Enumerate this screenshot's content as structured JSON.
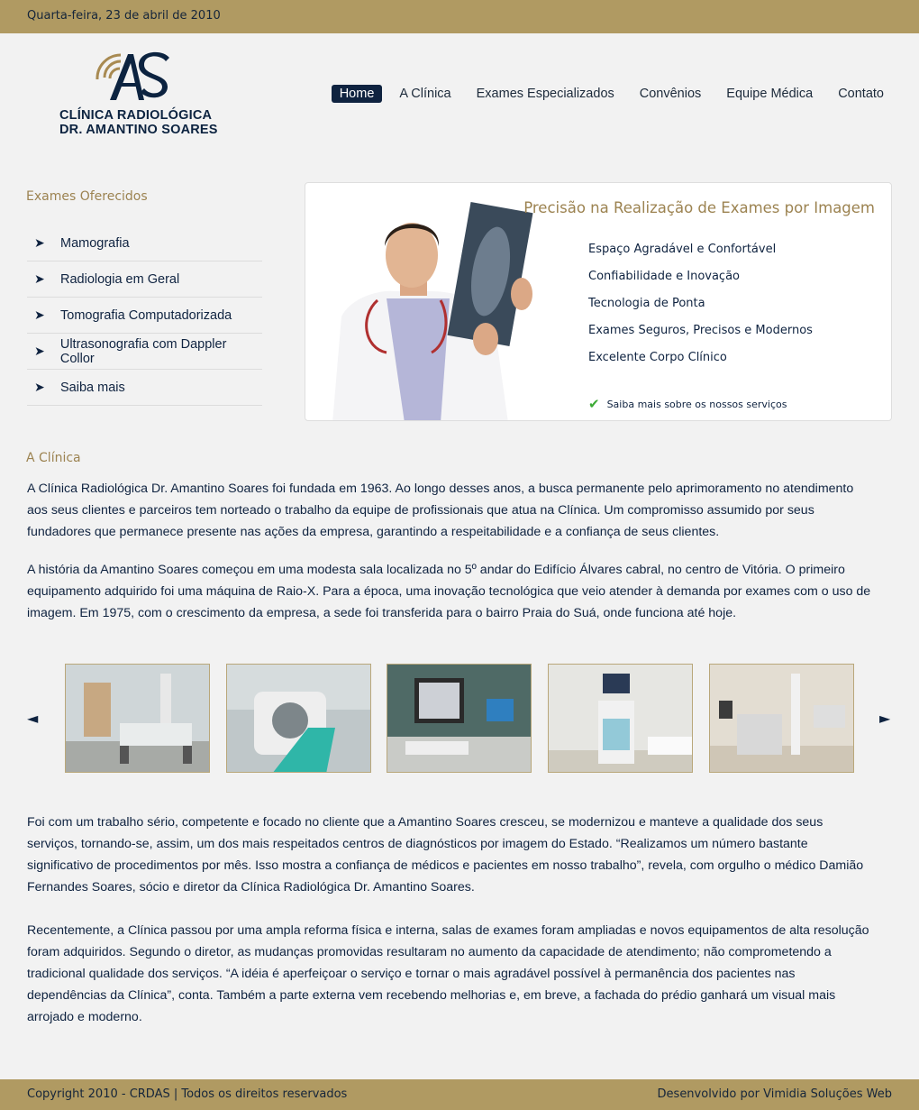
{
  "header": {
    "date": "Quarta-feira, 23 de abril de 2010"
  },
  "logo": {
    "line1": "CLÍNICA  RADIOLÓGICA",
    "line2": "DR. AMANTINO SOARES",
    "mark": "AS"
  },
  "nav": {
    "items": [
      "Home",
      "A Clínica",
      "Exames Especializados",
      "Convênios",
      "Equipe Médica",
      "Contato"
    ],
    "active": "Home"
  },
  "sidebar": {
    "title": "Exames Oferecidos",
    "items": [
      "Mamografia",
      "Radiologia em Geral",
      "Tomografia Computadorizada",
      "Ultrasonografia com Dappler Collor",
      "Saiba mais"
    ]
  },
  "banner": {
    "title": "Precisão na Realização de Exames por Imagem",
    "features": [
      "Espaço Agradável e Confortável",
      "Confiabilidade e Inovação",
      "Tecnologia de Ponta",
      "Exames Seguros, Precisos e Modernos",
      "Excelente Corpo Clínico"
    ],
    "more_link": "Saiba mais sobre os nossos serviços"
  },
  "clinica": {
    "title": "A Clínica",
    "p1": "A Clínica Radiológica Dr. Amantino Soares foi fundada em 1963. Ao longo desses anos, a  busca permanente pelo aprimoramento no atendimento aos seus clientes e parceiros tem norteado o trabalho da equipe de profissionais que atua na Clínica. Um compromisso assumido por seus fundadores que permanece presente nas ações da empresa, garantindo a respeitabilidade e a confiança de seus clientes.",
    "p2": "A história da Amantino Soares começou em uma modesta sala localizada no 5º andar do Edifício Álvares cabral, no centro de Vitória. O primeiro equipamento adquirido foi uma máquina de Raio-X. Para a época, uma inovação tecnológica que veio atender à demanda por exames com o uso de imagem. Em 1975, com o crescimento da empresa, a sede foi transferida para o bairro Praia do Suá, onde funciona até hoje.",
    "p3": "Foi com um trabalho sério, competente e focado no cliente que a Amantino Soares cresceu, se modernizou e manteve a qualidade dos seus serviços, tornando-se, assim, um dos mais respeitados centros de diagnósticos por imagem do Estado. “Realizamos um número bastante significativo de procedimentos por mês. Isso mostra a confiança de médicos e pacientes em nosso trabalho”, revela, com orgulho o médico Damião Fernandes Soares, sócio e diretor da Clínica Radiológica Dr. Amantino Soares.",
    "p4": "Recentemente, a Clínica passou por uma ampla reforma física e interna, salas de exames foram ampliadas e novos equipamentos de alta resolução foram adquiridos. Segundo o diretor, as mudanças promovidas resultaram no aumento da capacidade de atendimento; não comprometendo a tradicional qualidade dos serviços. “A idéia é aperfeiçoar o serviço e tornar o mais agradável possível à permanência dos pacientes nas dependências da Clínica”, conta. Também a parte externa vem recebendo melhorias e, em breve, a fachada do prédio ganhará um visual mais arrojado e moderno."
  },
  "gallery": {
    "prev_icon": "◄",
    "next_icon": "►",
    "photos": [
      "x-ray-room-photo",
      "ct-scanner-photo",
      "workstation-photo",
      "ultrasound-photo",
      "x-ray-room-2-photo"
    ]
  },
  "footer": {
    "copyright": "Copyright 2010 - CRDAS | Todos os direitos reservados",
    "developer": "Desenvolvido por Vimidia Soluções Web"
  },
  "colors": {
    "bar": "#b09a62",
    "gold_text": "#9c8351",
    "navy": "#0f2340",
    "background": "#f2f2f2"
  }
}
